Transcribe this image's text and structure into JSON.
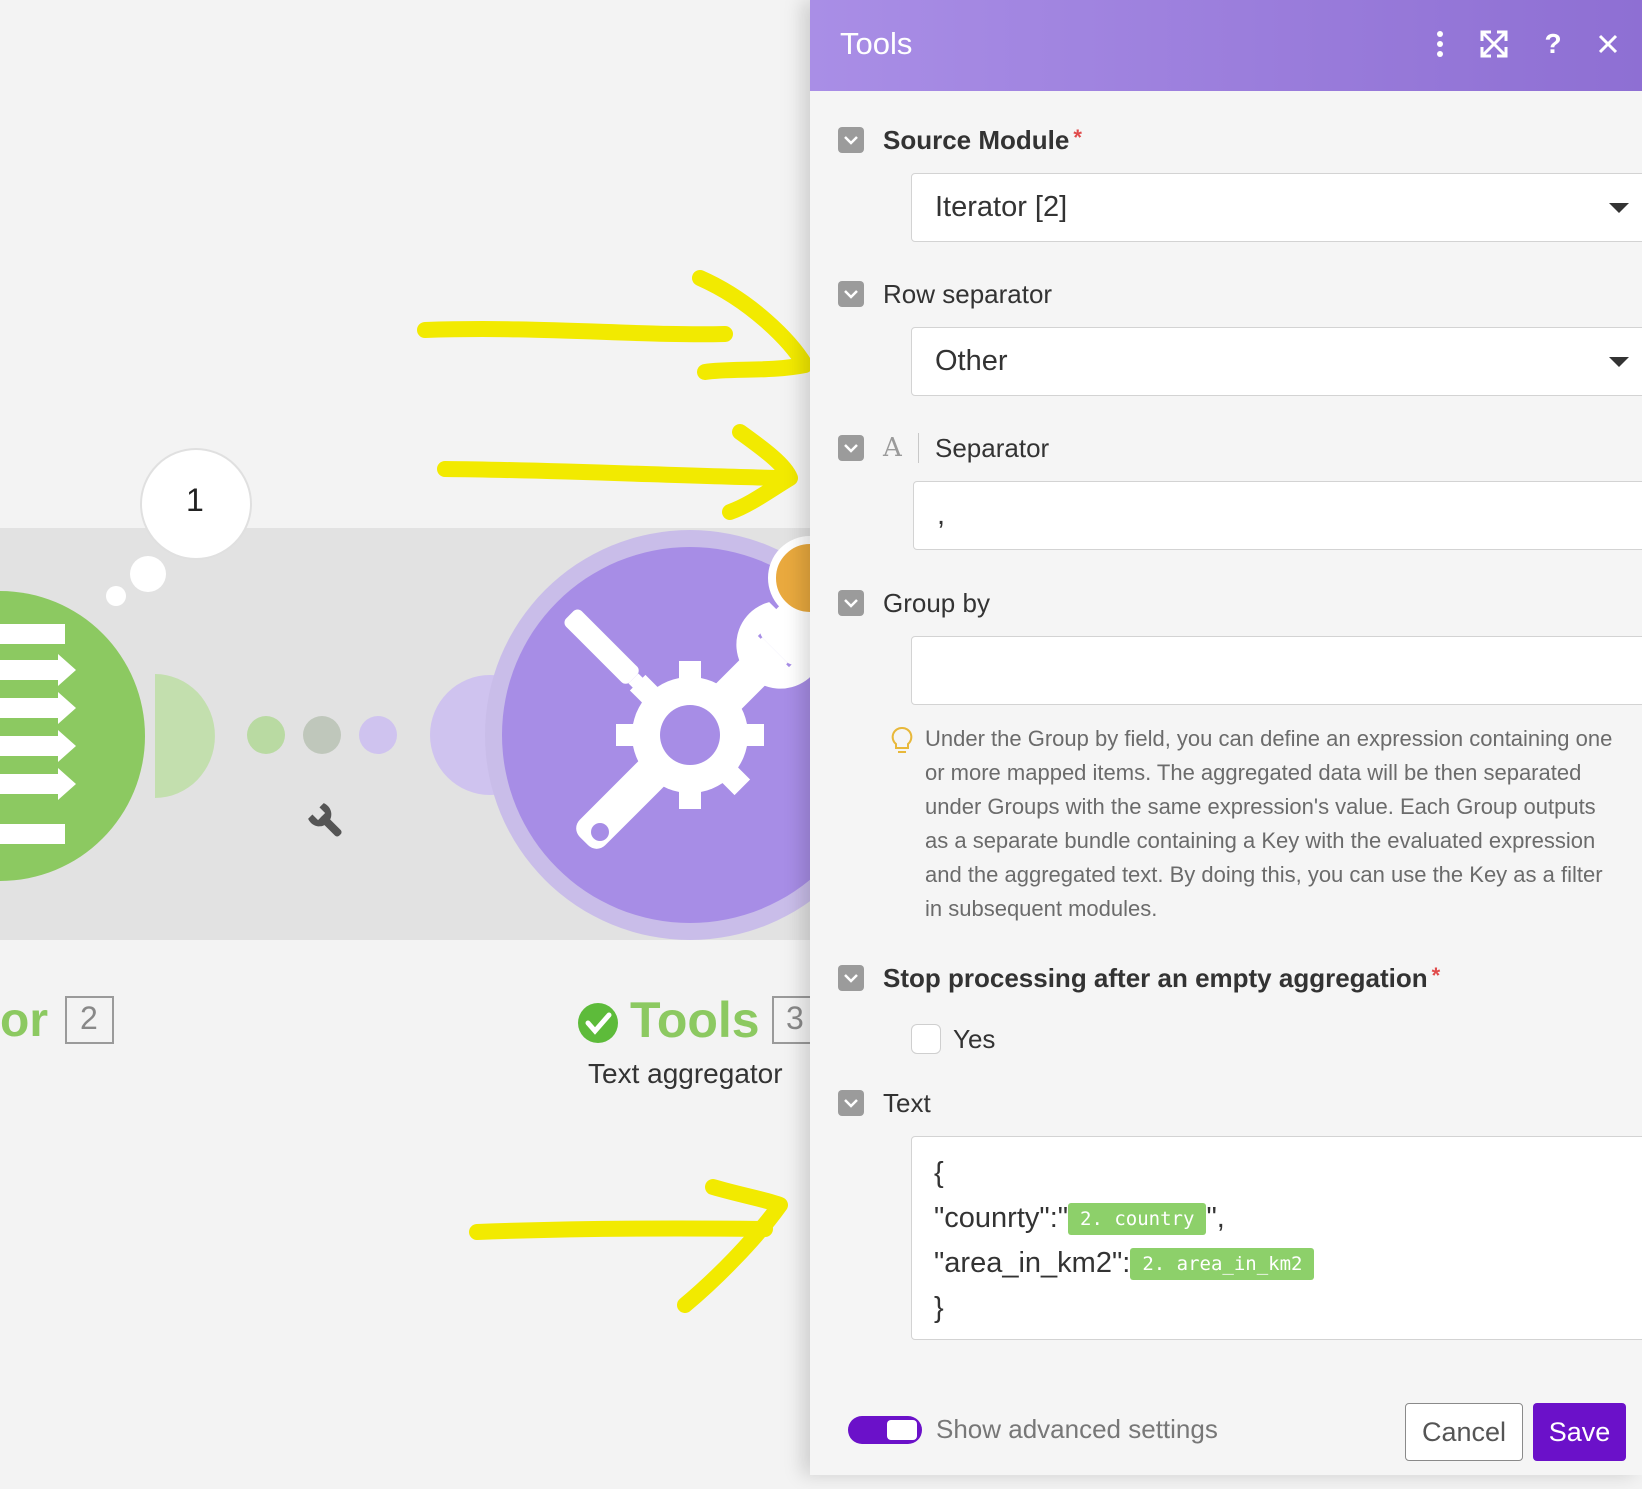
{
  "canvas": {
    "bubble_count": "1",
    "left_module_name_fragment": "or",
    "left_module_id": "2",
    "tools_module_name": "Tools",
    "tools_module_id": "3",
    "tools_module_subtitle": "Text aggregator"
  },
  "panel": {
    "title": "Tools",
    "header_icons": [
      "more-vert-icon",
      "expand-icon",
      "help-icon",
      "close-icon"
    ],
    "source_module": {
      "label": "Source Module",
      "required": "*",
      "value": "Iterator [2]"
    },
    "row_separator": {
      "label": "Row separator",
      "value": "Other"
    },
    "separator": {
      "type_icon_letter": "A",
      "label": "Separator",
      "value": ","
    },
    "group_by": {
      "label": "Group by",
      "value": "",
      "help": "Under the Group by field, you can define an expression containing one or more mapped items. The aggregated data will be then separated under Groups with the same expression's value. Each Group outputs as a separate bundle containing a Key with the evaluated expression and the aggregated text. By doing this, you can use the Key as a filter in subsequent modules."
    },
    "stop_processing": {
      "label": "Stop processing after an empty aggregation",
      "required": "*",
      "option_label": "Yes",
      "checked": false
    },
    "text": {
      "label": "Text",
      "line1": "{",
      "line2_prefix": "\"counrty\":\"",
      "line2_pill": "2. country",
      "line2_suffix": "\",",
      "line3_prefix": "\"area_in_km2\":",
      "line3_pill": "2. area_in_km2",
      "line4": "}"
    },
    "footer": {
      "advanced_label": "Show advanced settings",
      "advanced_enabled": true,
      "cancel_label": "Cancel",
      "save_label": "Save"
    }
  },
  "colors": {
    "header_start": "#a98ee6",
    "header_end": "#8e6fd3",
    "accent": "#6b11c9",
    "green_module": "#8cc961",
    "purple_module": "#a78de6",
    "annotation_yellow": "#f2ea00",
    "pill_green": "#8dd06a"
  }
}
